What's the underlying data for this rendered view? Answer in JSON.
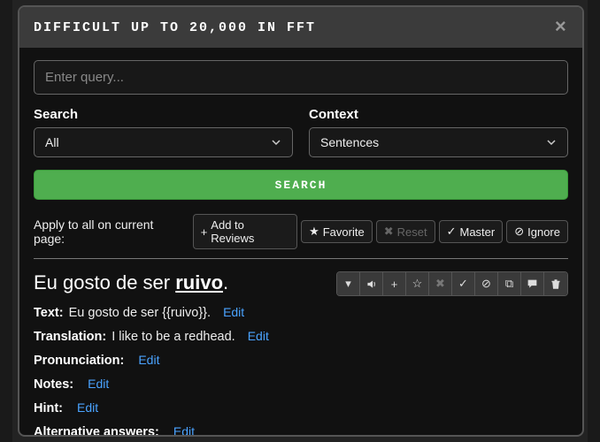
{
  "modal": {
    "title": "DIFFICULT UP TO 20,000 IN FFT",
    "close_icon": "×"
  },
  "query": {
    "placeholder": "Enter query...",
    "value": ""
  },
  "filters": {
    "search_label": "Search",
    "search_value": "All",
    "context_label": "Context",
    "context_value": "Sentences"
  },
  "search_button": "SEARCH",
  "bulk": {
    "lead": "Apply to all on current page:",
    "add": "Add to Reviews",
    "favorite": "Favorite",
    "reset": "Reset",
    "master": "Master",
    "ignore": "Ignore"
  },
  "card": {
    "sentence_prefix": "Eu gosto de ser ",
    "sentence_cloze": "ruivo",
    "sentence_suffix": ".",
    "fields": {
      "text_k": "Text:",
      "text_v": "Eu gosto de ser {{ruivo}}.",
      "translation_k": "Translation:",
      "translation_v": "I like to be a redhead.",
      "pronunciation_k": "Pronunciation:",
      "pronunciation_v": "",
      "notes_k": "Notes:",
      "notes_v": "",
      "hint_k": "Hint:",
      "hint_v": "",
      "alt_k": "Alternative answers:",
      "alt_v": ""
    },
    "edit": "Edit"
  },
  "icons": {
    "plus": "+",
    "star": "★",
    "star_outline": "☆",
    "x": "✖",
    "check": "✓",
    "ban": "⊘",
    "copy": "⧉",
    "comment": "💬",
    "trash": "🗑",
    "chevron_down": "▾",
    "sound": "🔊"
  }
}
